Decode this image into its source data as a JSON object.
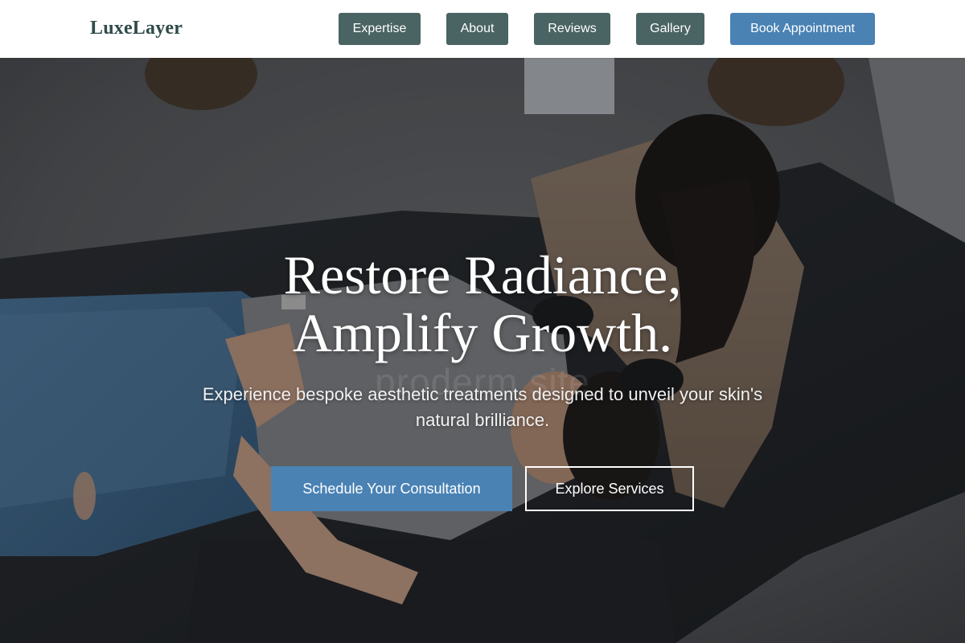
{
  "header": {
    "logo": "LuxeLayer",
    "nav": {
      "expertise": "Expertise",
      "about": "About",
      "reviews": "Reviews",
      "gallery": "Gallery",
      "book": "Book Appointment"
    }
  },
  "hero": {
    "title_line1": "Restore Radiance,",
    "title_line2": "Amplify Growth.",
    "subtitle": "Experience bespoke aesthetic treatments designed to unveil your skin's natural brilliance.",
    "watermark": "proderm site",
    "cta_primary": "Schedule Your Consultation",
    "cta_secondary": "Explore Services"
  },
  "colors": {
    "brand_dark": "#2f4b49",
    "nav_button": "#4a6363",
    "accent": "#4a82b4",
    "header_bg": "#ffffff"
  }
}
